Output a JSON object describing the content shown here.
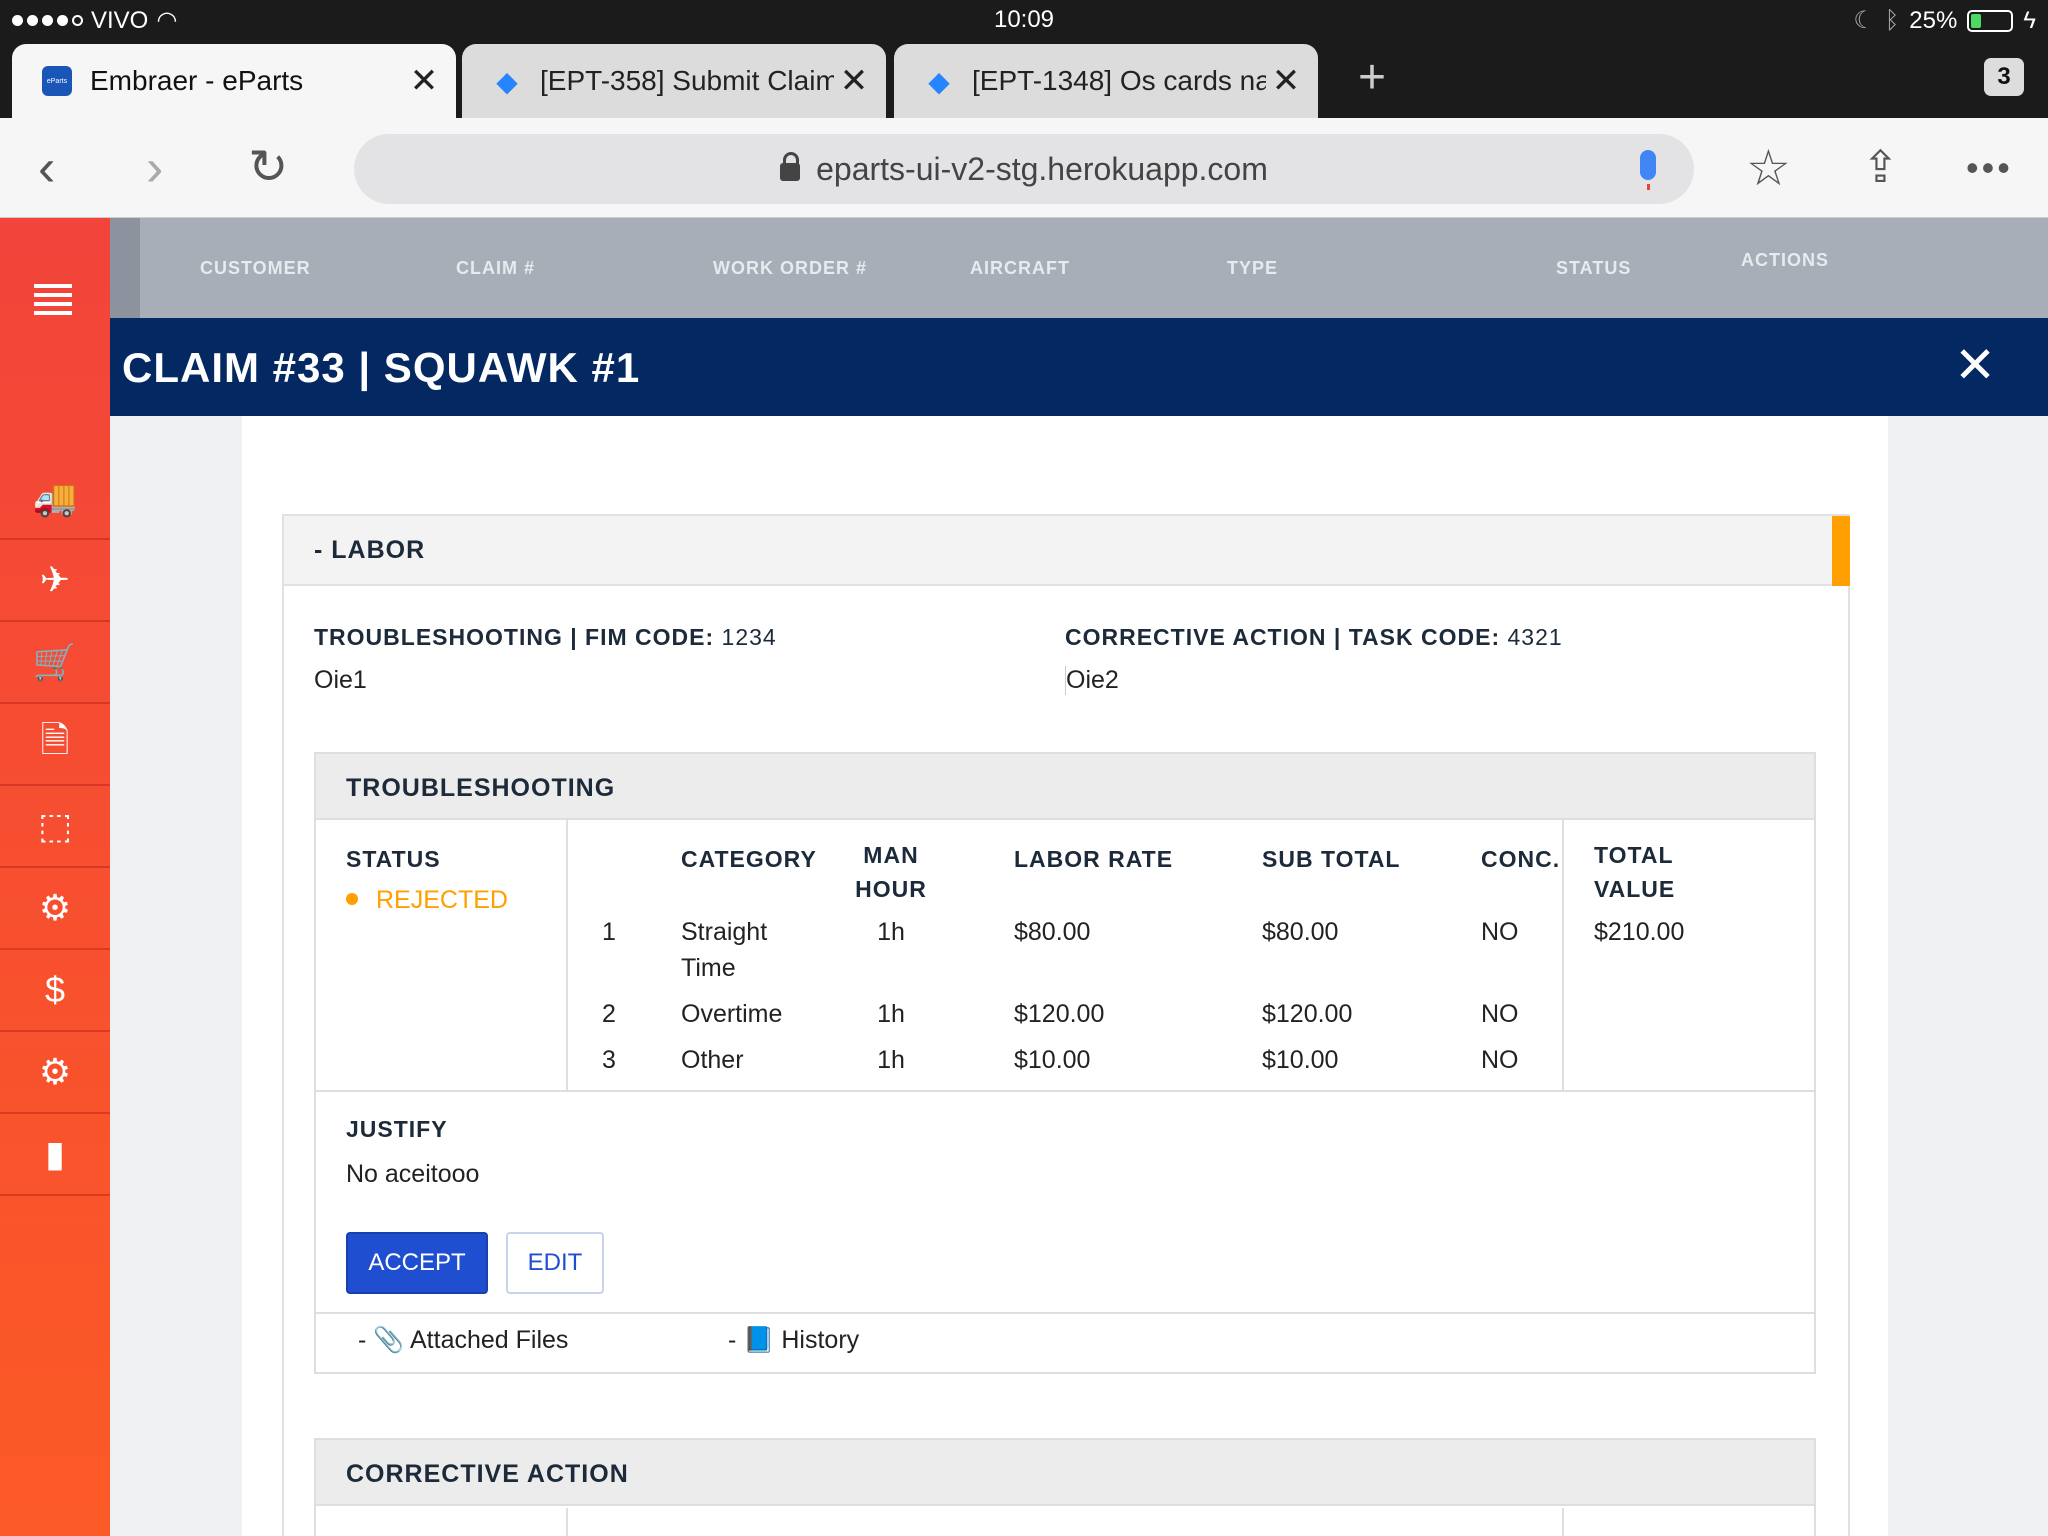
{
  "status_bar": {
    "carrier": "VIVO",
    "time": "10:09",
    "battery": "25%",
    "battery_level": 0.25
  },
  "browser": {
    "tabs": [
      {
        "title": "Embraer - eParts",
        "favicon": "eparts-logo",
        "favicon_text": "eParts",
        "active": true
      },
      {
        "title": "[EPT-358] Submit Claim",
        "favicon": "jira-icon",
        "active": false
      },
      {
        "title": "[EPT-1348] Os cards na",
        "favicon": "jira-icon",
        "active": false
      }
    ],
    "tab_count": "3",
    "url": "eparts-ui-v2-stg.herokuapp.com"
  },
  "sidebar": {
    "items": [
      {
        "icon": "truck-icon",
        "glyph": "🚚"
      },
      {
        "icon": "airplane-icon",
        "glyph": "✈"
      },
      {
        "icon": "cart-icon",
        "glyph": "🛒"
      },
      {
        "icon": "document-icon",
        "glyph": "🗎"
      },
      {
        "icon": "package-return-icon",
        "glyph": "⬚"
      },
      {
        "icon": "gear-exchange-icon",
        "glyph": "⚙"
      },
      {
        "icon": "dollar-cycle-icon",
        "glyph": "$"
      },
      {
        "icon": "gears-icon",
        "glyph": "⚙"
      },
      {
        "icon": "bar-chart-icon",
        "glyph": "▮"
      }
    ]
  },
  "grid_header": {
    "columns": [
      "CUSTOMER",
      "CLAIM #",
      "WORK ORDER #",
      "AIRCRAFT",
      "TYPE",
      "STATUS",
      "ACTIONS"
    ]
  },
  "modal": {
    "title": "CLAIM #33 | SQUAWK #1",
    "labor": {
      "title": "- LABOR",
      "troubleshooting_code": {
        "label": "TROUBLESHOOTING | FIM CODE:",
        "value": "1234",
        "text": "Oie1"
      },
      "corrective_code": {
        "label": "CORRECTIVE ACTION | TASK CODE:",
        "value": "4321",
        "text": "Oie2"
      },
      "troubleshooting": {
        "title": "TROUBLESHOOTING",
        "status_label": "STATUS",
        "status_value": "REJECTED",
        "headers": {
          "category": "CATEGORY",
          "man_hour_1": "MAN",
          "man_hour_2": "HOUR",
          "labor_rate": "LABOR RATE",
          "sub_total": "SUB TOTAL",
          "conc": "CONC.",
          "total_value_1": "TOTAL",
          "total_value_2": "VALUE"
        },
        "rows": [
          {
            "n": "1",
            "category_1": "Straight",
            "category_2": "Time",
            "man_hour": "1h",
            "labor_rate": "$80.00",
            "sub_total": "$80.00",
            "conc": "NO"
          },
          {
            "n": "2",
            "category_1": "Overtime",
            "category_2": "",
            "man_hour": "1h",
            "labor_rate": "$120.00",
            "sub_total": "$120.00",
            "conc": "NO"
          },
          {
            "n": "3",
            "category_1": "Other",
            "category_2": "",
            "man_hour": "1h",
            "labor_rate": "$10.00",
            "sub_total": "$10.00",
            "conc": "NO"
          }
        ],
        "total_value": "$210.00",
        "justify_label": "JUSTIFY",
        "justify_text": "No aceitooo",
        "accept_label": "ACCEPT",
        "edit_label": "EDIT",
        "attached_files": "Attached Files",
        "history": "History"
      },
      "corrective_action": {
        "title": "CORRECTIVE ACTION"
      }
    }
  }
}
